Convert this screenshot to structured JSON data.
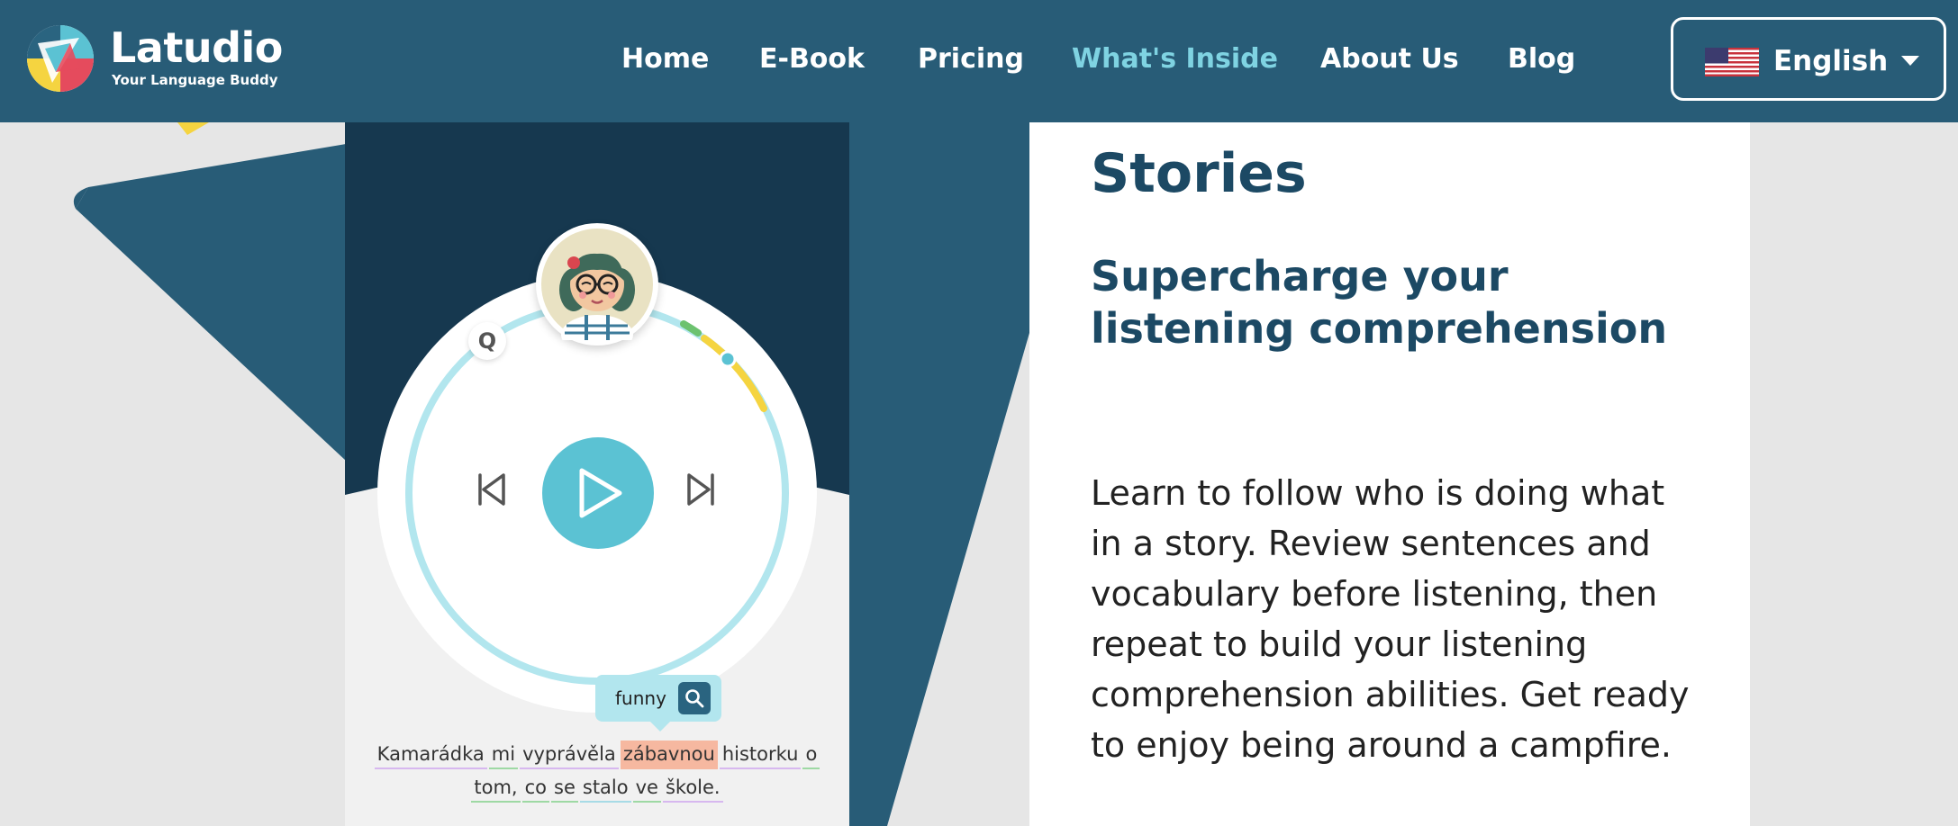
{
  "brand": {
    "name": "Latudio",
    "tagline": "Your Language Buddy"
  },
  "nav": {
    "items": [
      {
        "label": "Home",
        "active": false
      },
      {
        "label": "E-Book",
        "active": false
      },
      {
        "label": "Pricing",
        "active": false
      },
      {
        "label": "What's Inside",
        "active": true
      },
      {
        "label": "About Us",
        "active": false
      },
      {
        "label": "Blog",
        "active": false
      }
    ]
  },
  "language": {
    "selected": "English",
    "flag_icon": "us-flag-icon"
  },
  "player": {
    "q_label": "Q",
    "tooltip_word": "funny",
    "sentence_line1": [
      "Kamarádka",
      "mi",
      "vyprávěla",
      "zábavnou",
      "historku",
      "o"
    ],
    "sentence_line2": [
      "tom,",
      "co",
      "se",
      "stalo",
      "ve",
      "škole."
    ],
    "highlighted_word": "zábavnou"
  },
  "content": {
    "title": "Stories",
    "subtitle": "Supercharge your listening comprehension",
    "body": "Learn to follow who is doing what in a story. Review sentences and vocabulary before listening, then repeat to build your listening comprehension abilities. Get ready to enjoy being around a campfire."
  },
  "colors": {
    "header_bg": "#285c77",
    "nav_active": "#7fd3e2",
    "heading": "#1c4964",
    "accent_teal": "#5bc2d3",
    "word_highlight": "#f6b8a0"
  }
}
